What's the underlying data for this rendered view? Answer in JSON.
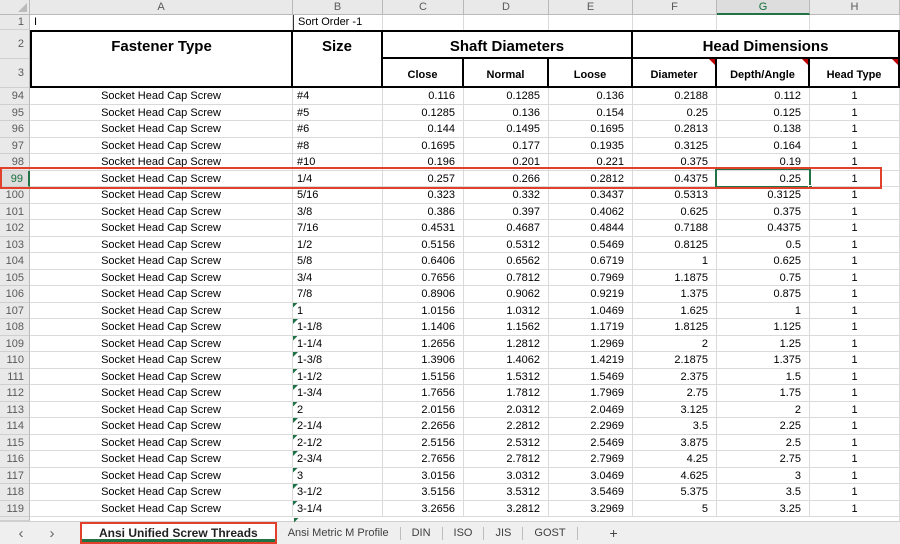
{
  "colors": {
    "excel_green": "#217346",
    "selected_header_green": "#13703C",
    "annotation_red": "#E1402A",
    "comment_indicator_red": "#C00000",
    "text_flag_green": "#1E7145",
    "header_gray": "#E9E9E9"
  },
  "sheet": {
    "column_headers": [
      "A",
      "B",
      "C",
      "D",
      "E",
      "F",
      "G",
      "H"
    ],
    "selected_column": "G",
    "selected_row": 99,
    "active_cell": {
      "ref": "G99",
      "value": "0.25"
    },
    "top_row_numbers": [
      "1",
      "2",
      "3"
    ],
    "formula_row": {
      "a1": "I",
      "b1": "Sort Order -1"
    },
    "table_header": {
      "fastener_type": "Fastener Type",
      "size": "Size",
      "shaft_diameters": "Shaft Diameters",
      "head_dimensions": "Head Dimensions",
      "sub": {
        "close": "Close",
        "normal": "Normal",
        "loose": "Loose",
        "diameter": "Diameter",
        "depth_angle": "Depth/Angle",
        "head_type": "Head Type"
      },
      "comment_marker_cells": [
        "F3",
        "G3",
        "H3"
      ]
    },
    "rows": [
      {
        "n": 94,
        "type": "Socket Head Cap Screw",
        "size": "#4",
        "flag": false,
        "close": "0.116",
        "normal": "0.1285",
        "loose": "0.136",
        "diameter": "0.2188",
        "depth_angle": "0.112",
        "head_type": "1"
      },
      {
        "n": 95,
        "type": "Socket Head Cap Screw",
        "size": "#5",
        "flag": false,
        "close": "0.1285",
        "normal": "0.136",
        "loose": "0.154",
        "diameter": "0.25",
        "depth_angle": "0.125",
        "head_type": "1"
      },
      {
        "n": 96,
        "type": "Socket Head Cap Screw",
        "size": "#6",
        "flag": false,
        "close": "0.144",
        "normal": "0.1495",
        "loose": "0.1695",
        "diameter": "0.2813",
        "depth_angle": "0.138",
        "head_type": "1"
      },
      {
        "n": 97,
        "type": "Socket Head Cap Screw",
        "size": "#8",
        "flag": false,
        "close": "0.1695",
        "normal": "0.177",
        "loose": "0.1935",
        "diameter": "0.3125",
        "depth_angle": "0.164",
        "head_type": "1"
      },
      {
        "n": 98,
        "type": "Socket Head Cap Screw",
        "size": "#10",
        "flag": false,
        "close": "0.196",
        "normal": "0.201",
        "loose": "0.221",
        "diameter": "0.375",
        "depth_angle": "0.19",
        "head_type": "1"
      },
      {
        "n": 99,
        "type": "Socket Head Cap Screw",
        "size": "1/4",
        "flag": false,
        "close": "0.257",
        "normal": "0.266",
        "loose": "0.2812",
        "diameter": "0.4375",
        "depth_angle": "0.25",
        "head_type": "1"
      },
      {
        "n": 100,
        "type": "Socket Head Cap Screw",
        "size": "5/16",
        "flag": false,
        "close": "0.323",
        "normal": "0.332",
        "loose": "0.3437",
        "diameter": "0.5313",
        "depth_angle": "0.3125",
        "head_type": "1"
      },
      {
        "n": 101,
        "type": "Socket Head Cap Screw",
        "size": "3/8",
        "flag": false,
        "close": "0.386",
        "normal": "0.397",
        "loose": "0.4062",
        "diameter": "0.625",
        "depth_angle": "0.375",
        "head_type": "1"
      },
      {
        "n": 102,
        "type": "Socket Head Cap Screw",
        "size": "7/16",
        "flag": false,
        "close": "0.4531",
        "normal": "0.4687",
        "loose": "0.4844",
        "diameter": "0.7188",
        "depth_angle": "0.4375",
        "head_type": "1"
      },
      {
        "n": 103,
        "type": "Socket Head Cap Screw",
        "size": "1/2",
        "flag": false,
        "close": "0.5156",
        "normal": "0.5312",
        "loose": "0.5469",
        "diameter": "0.8125",
        "depth_angle": "0.5",
        "head_type": "1"
      },
      {
        "n": 104,
        "type": "Socket Head Cap Screw",
        "size": "5/8",
        "flag": false,
        "close": "0.6406",
        "normal": "0.6562",
        "loose": "0.6719",
        "diameter": "1",
        "depth_angle": "0.625",
        "head_type": "1"
      },
      {
        "n": 105,
        "type": "Socket Head Cap Screw",
        "size": "3/4",
        "flag": false,
        "close": "0.7656",
        "normal": "0.7812",
        "loose": "0.7969",
        "diameter": "1.1875",
        "depth_angle": "0.75",
        "head_type": "1"
      },
      {
        "n": 106,
        "type": "Socket Head Cap Screw",
        "size": "7/8",
        "flag": false,
        "close": "0.8906",
        "normal": "0.9062",
        "loose": "0.9219",
        "diameter": "1.375",
        "depth_angle": "0.875",
        "head_type": "1"
      },
      {
        "n": 107,
        "type": "Socket Head Cap Screw",
        "size": "1",
        "flag": true,
        "close": "1.0156",
        "normal": "1.0312",
        "loose": "1.0469",
        "diameter": "1.625",
        "depth_angle": "1",
        "head_type": "1"
      },
      {
        "n": 108,
        "type": "Socket Head Cap Screw",
        "size": "1-1/8",
        "flag": true,
        "close": "1.1406",
        "normal": "1.1562",
        "loose": "1.1719",
        "diameter": "1.8125",
        "depth_angle": "1.125",
        "head_type": "1"
      },
      {
        "n": 109,
        "type": "Socket Head Cap Screw",
        "size": "1-1/4",
        "flag": true,
        "close": "1.2656",
        "normal": "1.2812",
        "loose": "1.2969",
        "diameter": "2",
        "depth_angle": "1.25",
        "head_type": "1"
      },
      {
        "n": 110,
        "type": "Socket Head Cap Screw",
        "size": "1-3/8",
        "flag": true,
        "close": "1.3906",
        "normal": "1.4062",
        "loose": "1.4219",
        "diameter": "2.1875",
        "depth_angle": "1.375",
        "head_type": "1"
      },
      {
        "n": 111,
        "type": "Socket Head Cap Screw",
        "size": "1-1/2",
        "flag": true,
        "close": "1.5156",
        "normal": "1.5312",
        "loose": "1.5469",
        "diameter": "2.375",
        "depth_angle": "1.5",
        "head_type": "1"
      },
      {
        "n": 112,
        "type": "Socket Head Cap Screw",
        "size": "1-3/4",
        "flag": true,
        "close": "1.7656",
        "normal": "1.7812",
        "loose": "1.7969",
        "diameter": "2.75",
        "depth_angle": "1.75",
        "head_type": "1"
      },
      {
        "n": 113,
        "type": "Socket Head Cap Screw",
        "size": "2",
        "flag": true,
        "close": "2.0156",
        "normal": "2.0312",
        "loose": "2.0469",
        "diameter": "3.125",
        "depth_angle": "2",
        "head_type": "1"
      },
      {
        "n": 114,
        "type": "Socket Head Cap Screw",
        "size": "2-1/4",
        "flag": true,
        "close": "2.2656",
        "normal": "2.2812",
        "loose": "2.2969",
        "diameter": "3.5",
        "depth_angle": "2.25",
        "head_type": "1"
      },
      {
        "n": 115,
        "type": "Socket Head Cap Screw",
        "size": "2-1/2",
        "flag": true,
        "close": "2.5156",
        "normal": "2.5312",
        "loose": "2.5469",
        "diameter": "3.875",
        "depth_angle": "2.5",
        "head_type": "1"
      },
      {
        "n": 116,
        "type": "Socket Head Cap Screw",
        "size": "2-3/4",
        "flag": true,
        "close": "2.7656",
        "normal": "2.7812",
        "loose": "2.7969",
        "diameter": "4.25",
        "depth_angle": "2.75",
        "head_type": "1"
      },
      {
        "n": 117,
        "type": "Socket Head Cap Screw",
        "size": "3",
        "flag": true,
        "close": "3.0156",
        "normal": "3.0312",
        "loose": "3.0469",
        "diameter": "4.625",
        "depth_angle": "3",
        "head_type": "1"
      },
      {
        "n": 118,
        "type": "Socket Head Cap Screw",
        "size": "3-1/2",
        "flag": true,
        "close": "3.5156",
        "normal": "3.5312",
        "loose": "3.5469",
        "diameter": "5.375",
        "depth_angle": "3.5",
        "head_type": "1"
      },
      {
        "n": 119,
        "type": "Socket Head Cap Screw",
        "size": "3-1/4",
        "flag": true,
        "close": "3.2656",
        "normal": "3.2812",
        "loose": "3.2969",
        "diameter": "5",
        "depth_angle": "3.25",
        "head_type": "1"
      }
    ]
  },
  "tab_bar": {
    "prev_icon": "‹",
    "next_icon": "›",
    "tabs": [
      {
        "label": "Ansi Unified Screw Threads",
        "active": true,
        "annotated": true
      },
      {
        "label": "Ansi Metric M Profile",
        "active": false
      },
      {
        "label": "DIN",
        "active": false
      },
      {
        "label": "ISO",
        "active": false
      },
      {
        "label": "JIS",
        "active": false
      },
      {
        "label": "GOST",
        "active": false
      }
    ],
    "add_label": "+"
  }
}
